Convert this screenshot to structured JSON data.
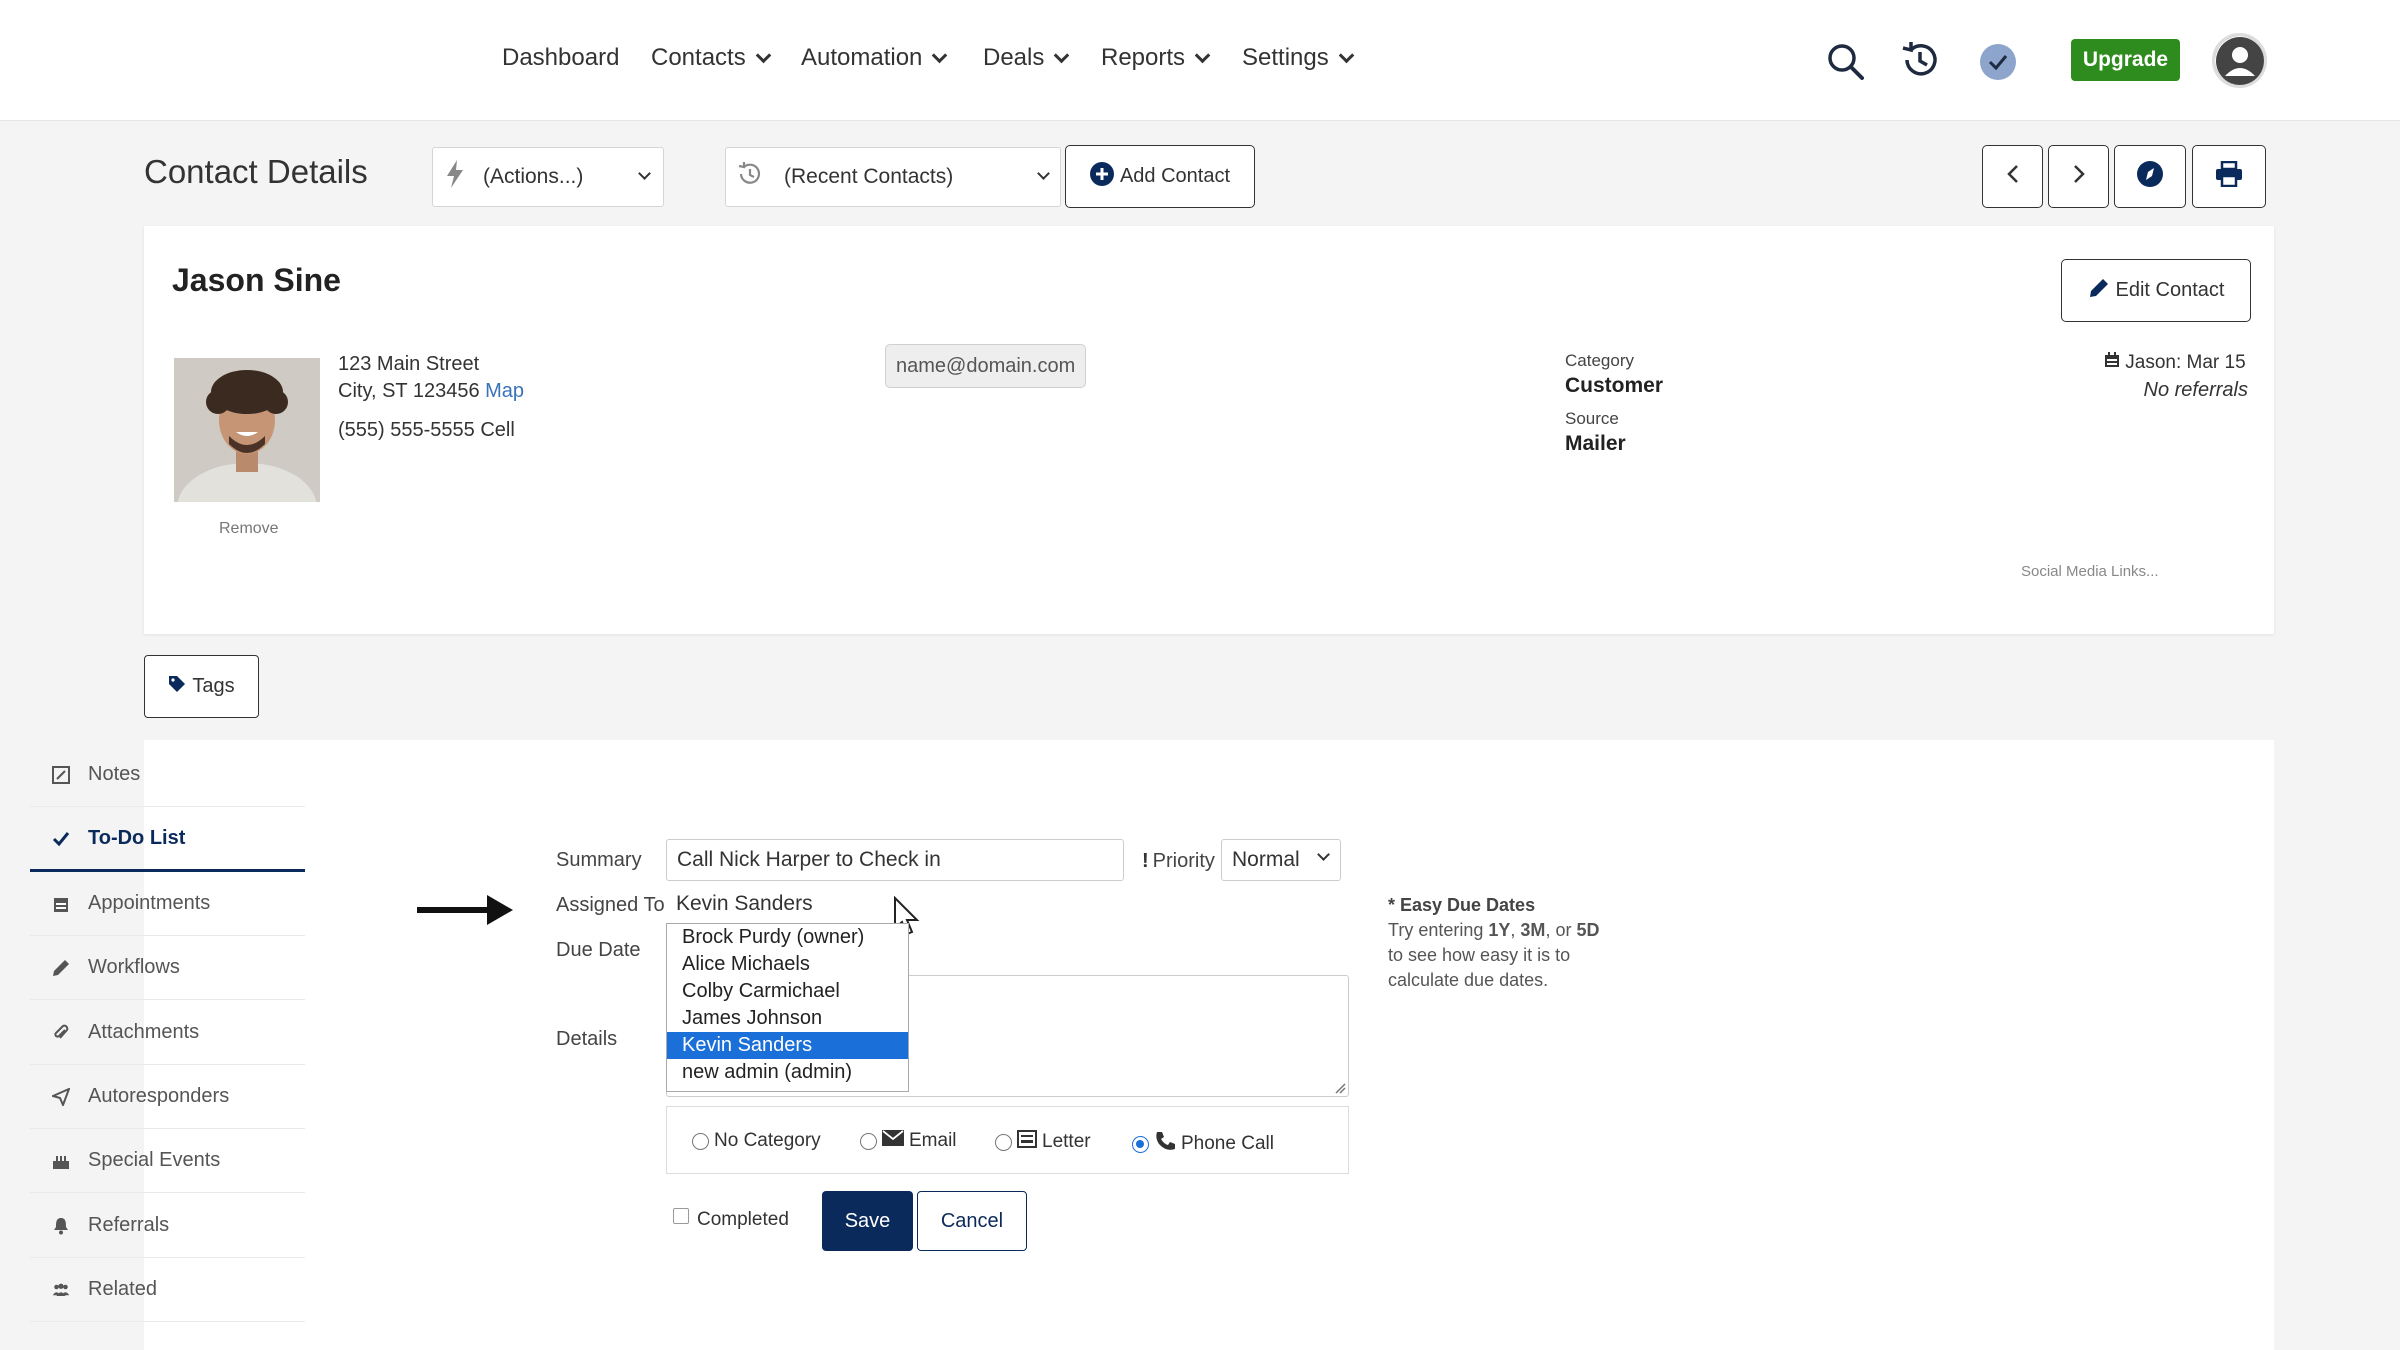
{
  "nav": {
    "items": [
      {
        "label": "Dashboard",
        "dropdown": false
      },
      {
        "label": "Contacts",
        "dropdown": true
      },
      {
        "label": "Automation",
        "dropdown": true
      },
      {
        "label": "Deals",
        "dropdown": true
      },
      {
        "label": "Reports",
        "dropdown": true
      },
      {
        "label": "Settings",
        "dropdown": true
      }
    ],
    "upgrade_label": "Upgrade"
  },
  "header": {
    "title": "Contact Details",
    "actions_select": "(Actions...)",
    "recent_select": "(Recent Contacts)",
    "add_contact": "Add Contact"
  },
  "contact": {
    "name": "Jason Sine",
    "edit_label": "Edit Contact",
    "address_line1": "123 Main Street",
    "address_line2": "City, ST 123456",
    "map_link": "Map",
    "phone": "(555) 555-5555 Cell",
    "photo_remove": "Remove",
    "email": "name@domain.com",
    "category_label": "Category",
    "category_value": "Customer",
    "source_label": "Source",
    "source_value": "Mailer",
    "birthday": "Jason: Mar 15",
    "referrals": "No referrals",
    "social_links": "Social Media Links..."
  },
  "tags_label": "Tags",
  "sidebar": {
    "items": [
      {
        "label": "Notes"
      },
      {
        "label": "To-Do List"
      },
      {
        "label": "Appointments"
      },
      {
        "label": "Workflows"
      },
      {
        "label": "Attachments"
      },
      {
        "label": "Autoresponders"
      },
      {
        "label": "Special Events"
      },
      {
        "label": "Referrals"
      },
      {
        "label": "Related"
      }
    ]
  },
  "todo": {
    "summary_label": "Summary",
    "summary_value": "Call Nick Harper to Check in",
    "priority_label": "Priority",
    "priority_value": "Normal",
    "assigned_label": "Assigned To",
    "assigned_value": "Kevin Sanders",
    "due_label": "Due Date",
    "details_label": "Details",
    "assignee_options": [
      "Brock Purdy (owner)",
      "Alice Michaels",
      "Colby Carmichael",
      "James Johnson",
      "Kevin Sanders",
      "new admin (admin)"
    ],
    "tip_title": "* Easy Due Dates",
    "tip_line1_pre": "Try entering ",
    "tip_line1_b1": "1Y",
    "tip_line1_sep1": ", ",
    "tip_line1_b2": "3M",
    "tip_line1_sep2": ", or ",
    "tip_line1_b3": "5D",
    "tip_line2": "to see how easy it is to",
    "tip_line3": "calculate due dates.",
    "categories": [
      {
        "label": "No Category",
        "checked": false
      },
      {
        "label": "Email",
        "checked": false
      },
      {
        "label": "Letter",
        "checked": false
      },
      {
        "label": "Phone Call",
        "checked": true
      }
    ],
    "completed_label": "Completed",
    "save_label": "Save",
    "cancel_label": "Cancel"
  },
  "colors": {
    "upgrade": "#2e8b1e",
    "primary": "#0b2a5c",
    "selection": "#1a6fd8"
  }
}
